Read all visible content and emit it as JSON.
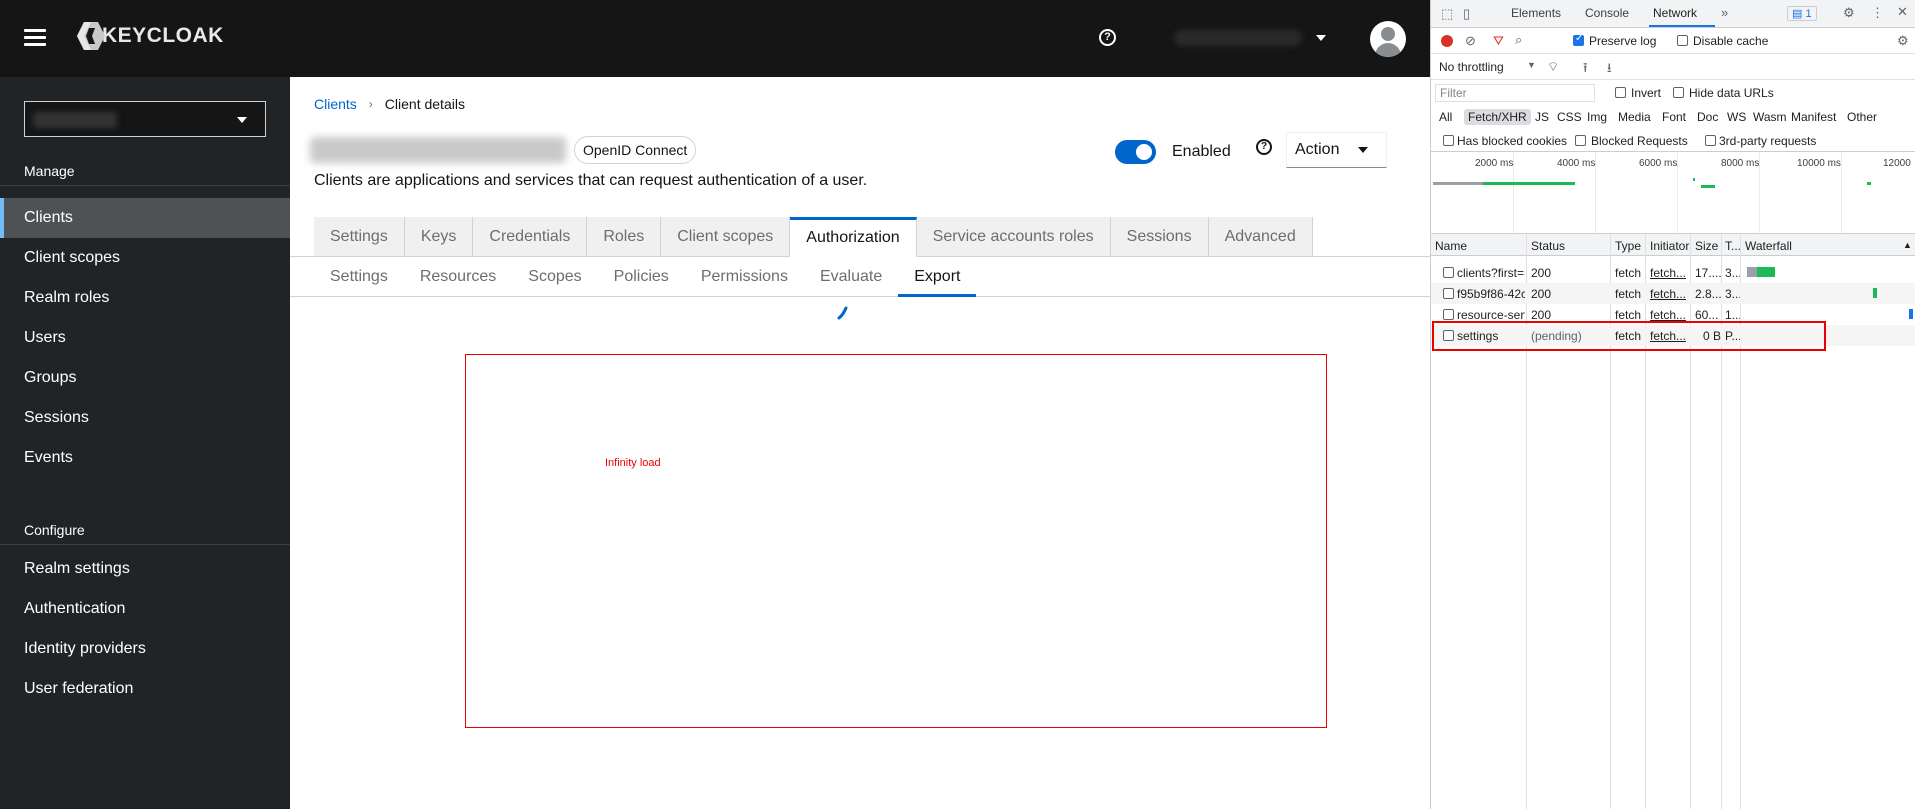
{
  "masthead": {
    "brand": "KEYCLOAK"
  },
  "sidebar": {
    "manage_heading": "Manage",
    "manage_items": [
      "Clients",
      "Client scopes",
      "Realm roles",
      "Users",
      "Groups",
      "Sessions",
      "Events"
    ],
    "configure_heading": "Configure",
    "configure_items": [
      "Realm settings",
      "Authentication",
      "Identity providers",
      "User federation"
    ]
  },
  "breadcrumb": {
    "root": "Clients",
    "current": "Client details"
  },
  "client": {
    "protocol_badge": "OpenID Connect",
    "description": "Clients are applications and services that can request authentication of a user.",
    "enabled_label": "Enabled",
    "action_label": "Action"
  },
  "tabs": [
    "Settings",
    "Keys",
    "Credentials",
    "Roles",
    "Client scopes",
    "Authorization",
    "Service accounts roles",
    "Sessions",
    "Advanced"
  ],
  "subtabs": [
    "Settings",
    "Resources",
    "Scopes",
    "Policies",
    "Permissions",
    "Evaluate",
    "Export"
  ],
  "annotation": {
    "text": "Infinity load",
    "color": "#e00000"
  },
  "devtools": {
    "tabs": [
      "Elements",
      "Console",
      "Network"
    ],
    "issues_count": "1",
    "preserve_log": "Preserve log",
    "disable_cache": "Disable cache",
    "throttling": "No throttling",
    "filter_placeholder": "Filter",
    "invert": "Invert",
    "hide_data_urls": "Hide data URLs",
    "types": [
      "All",
      "Fetch/XHR",
      "JS",
      "CSS",
      "Img",
      "Media",
      "Font",
      "Doc",
      "WS",
      "Wasm",
      "Manifest",
      "Other"
    ],
    "has_blocked_cookies": "Has blocked cookies",
    "blocked_requests": "Blocked Requests",
    "third_party": "3rd-party requests",
    "ticks": [
      "2000 ms",
      "4000 ms",
      "6000 ms",
      "8000 ms",
      "10000 ms",
      "12000"
    ],
    "columns": [
      "Name",
      "Status",
      "Type",
      "Initiator",
      "Size",
      "T...",
      "Waterfall"
    ],
    "rows": [
      {
        "name": "clients?first=...",
        "status": "200",
        "type": "fetch",
        "initiator": "fetch...",
        "size": "17....",
        "time": "3..."
      },
      {
        "name": "f95b9f86-42c...",
        "status": "200",
        "type": "fetch",
        "initiator": "fetch...",
        "size": "2.8...",
        "time": "3..."
      },
      {
        "name": "resource-server",
        "status": "200",
        "type": "fetch",
        "initiator": "fetch...",
        "size": "60...",
        "time": "1..."
      },
      {
        "name": "settings",
        "status": "(pending)",
        "type": "fetch",
        "initiator": "fetch...",
        "size": "0 B",
        "time": "P..."
      }
    ]
  },
  "colors": {
    "accent": "#0066cc",
    "masthead": "#151515",
    "sidebar": "#212427"
  }
}
